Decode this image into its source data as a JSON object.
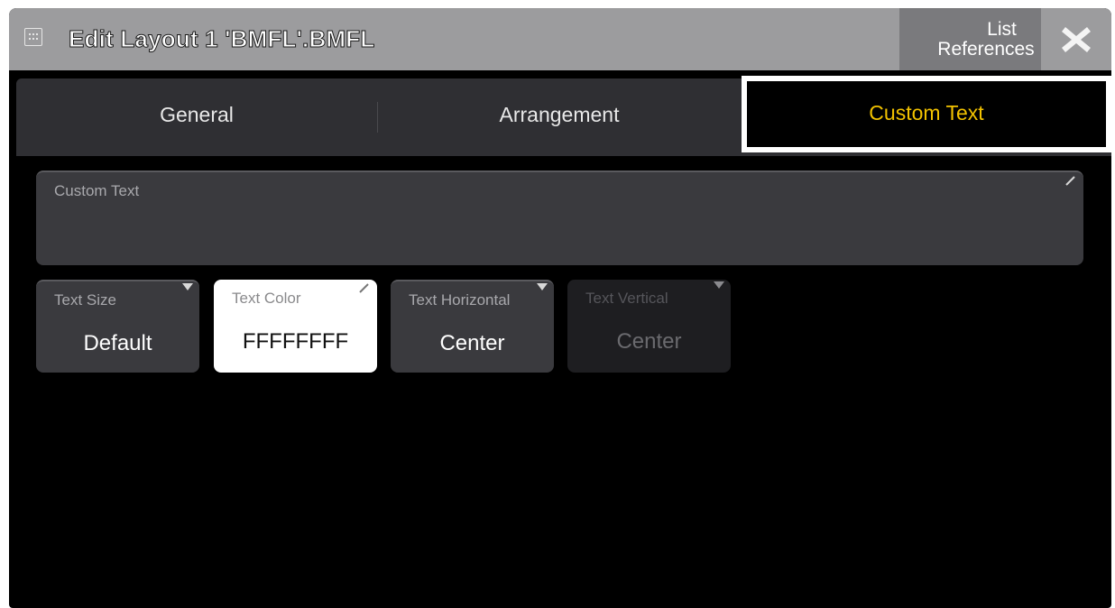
{
  "window": {
    "title": "Edit Layout 1 'BMFL'.BMFL",
    "list_references_line1": "List",
    "list_references_line2": "References",
    "close_icon": "close-x-icon"
  },
  "tabs": [
    {
      "label": "General",
      "active": false
    },
    {
      "label": "Arrangement",
      "active": false
    },
    {
      "label": "Custom Text",
      "active": true
    }
  ],
  "custom_text": {
    "label": "Custom Text",
    "value": ""
  },
  "properties": [
    {
      "label": "Text Size",
      "value": "Default",
      "enabled": true
    },
    {
      "label": "Text Color",
      "value": "FFFFFFFF",
      "enabled": true
    },
    {
      "label": "Text Horizontal",
      "value": "Center",
      "enabled": true
    },
    {
      "label": "Text Vertical",
      "value": "Center",
      "enabled": false
    }
  ],
  "colors": {
    "active_tab_text": "#f2c200",
    "titlebar": "#9c9c9e",
    "field_bg": "#3a3a3e"
  }
}
